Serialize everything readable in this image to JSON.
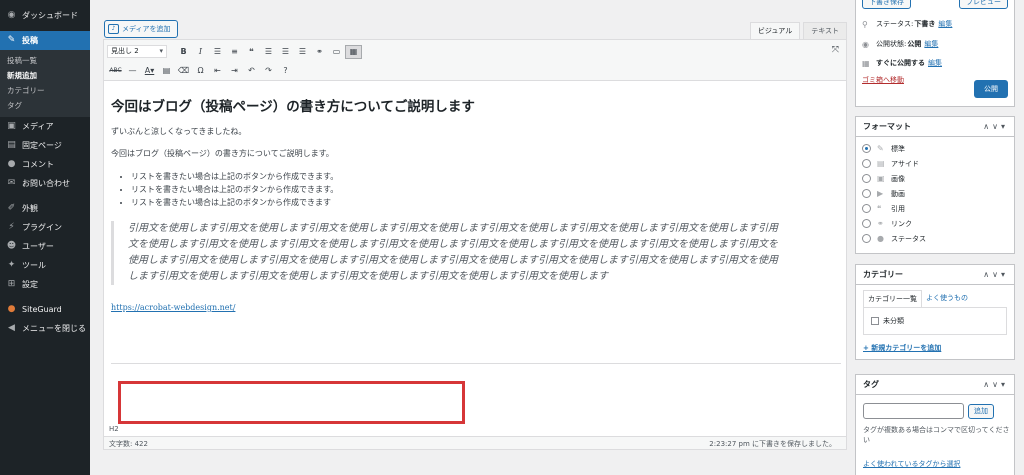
{
  "admin_menu": {
    "dashboard": "ダッシュボード",
    "posts": "投稿",
    "posts_sub": [
      "投稿一覧",
      "新規追加",
      "カテゴリー",
      "タグ"
    ],
    "media": "メディア",
    "pages": "固定ページ",
    "comments": "コメント",
    "contact": "お問い合わせ",
    "appearance": "外観",
    "plugins": "プラグイン",
    "users": "ユーザー",
    "tools": "ツール",
    "settings": "設定",
    "siteguard": "SiteGuard",
    "collapse": "メニューを閉じる"
  },
  "editor": {
    "add_media": "メディアを追加",
    "tab_visual": "ビジュアル",
    "tab_text": "テキスト",
    "format_select": "見出し 2",
    "path": "H2",
    "word_count": "文字数: 422",
    "last_saved": "2:23:27 pm に下書きを保存しました。"
  },
  "content": {
    "heading": "今回はブログ（投稿ページ）の書き方についてご説明します",
    "p1": "ずいぶんと涼しくなってきましたね。",
    "p2": "今回はブログ（投稿ページ）の書き方についてご説明します。",
    "list": [
      "リストを書きたい場合は上記のボタンから作成できます。",
      "リストを書きたい場合は上記のボタンから作成できます。",
      "リストを書きたい場合は上記のボタンから作成できます"
    ],
    "quote_lines": [
      "引用文を使用します引用文を使用します引用文を使用します引用文を使用します引用文を使用します引用文を使用します引用文を使用します引用",
      "文を使用します引用文を使用します引用文を使用します引用文を使用します引用文を使用します引用文を使用します引用文を使用します引用文を",
      "使用します引用文を使用します引用文を使用します引用文を使用します引用文を使用します引用文を使用します引用文を使用します引用文を使用",
      "します引用文を使用します引用文を使用します引用文を使用します引用文を使用します引用文を使用します"
    ],
    "link": "https://acrobat-webdesign.net/"
  },
  "publish": {
    "save_draft": "下書き保存",
    "preview": "プレビュー",
    "status_label": "ステータス:",
    "status_value": "下書き",
    "visibility_label": "公開状態:",
    "visibility_value": "公開",
    "schedule_label": "すぐに公開する",
    "edit": "編集",
    "trash": "ゴミ箱へ移動",
    "publish": "公開"
  },
  "format": {
    "title": "フォーマット",
    "items": [
      "標準",
      "アサイド",
      "画像",
      "動画",
      "引用",
      "リンク",
      "ステータス"
    ]
  },
  "category": {
    "title": "カテゴリー",
    "tab_all": "カテゴリー一覧",
    "tab_popular": "よく使うもの",
    "item": "未分類",
    "add_new": "+ 新規カテゴリーを追加"
  },
  "tags": {
    "title": "タグ",
    "add": "追加",
    "help": "タグが複数ある場合はコンマで区切ってください",
    "choose": "よく使われているタグから選択"
  },
  "colors": {
    "admin_bar": "#1d2327",
    "accent": "#2271b1",
    "highlight_box": "#d63638"
  }
}
